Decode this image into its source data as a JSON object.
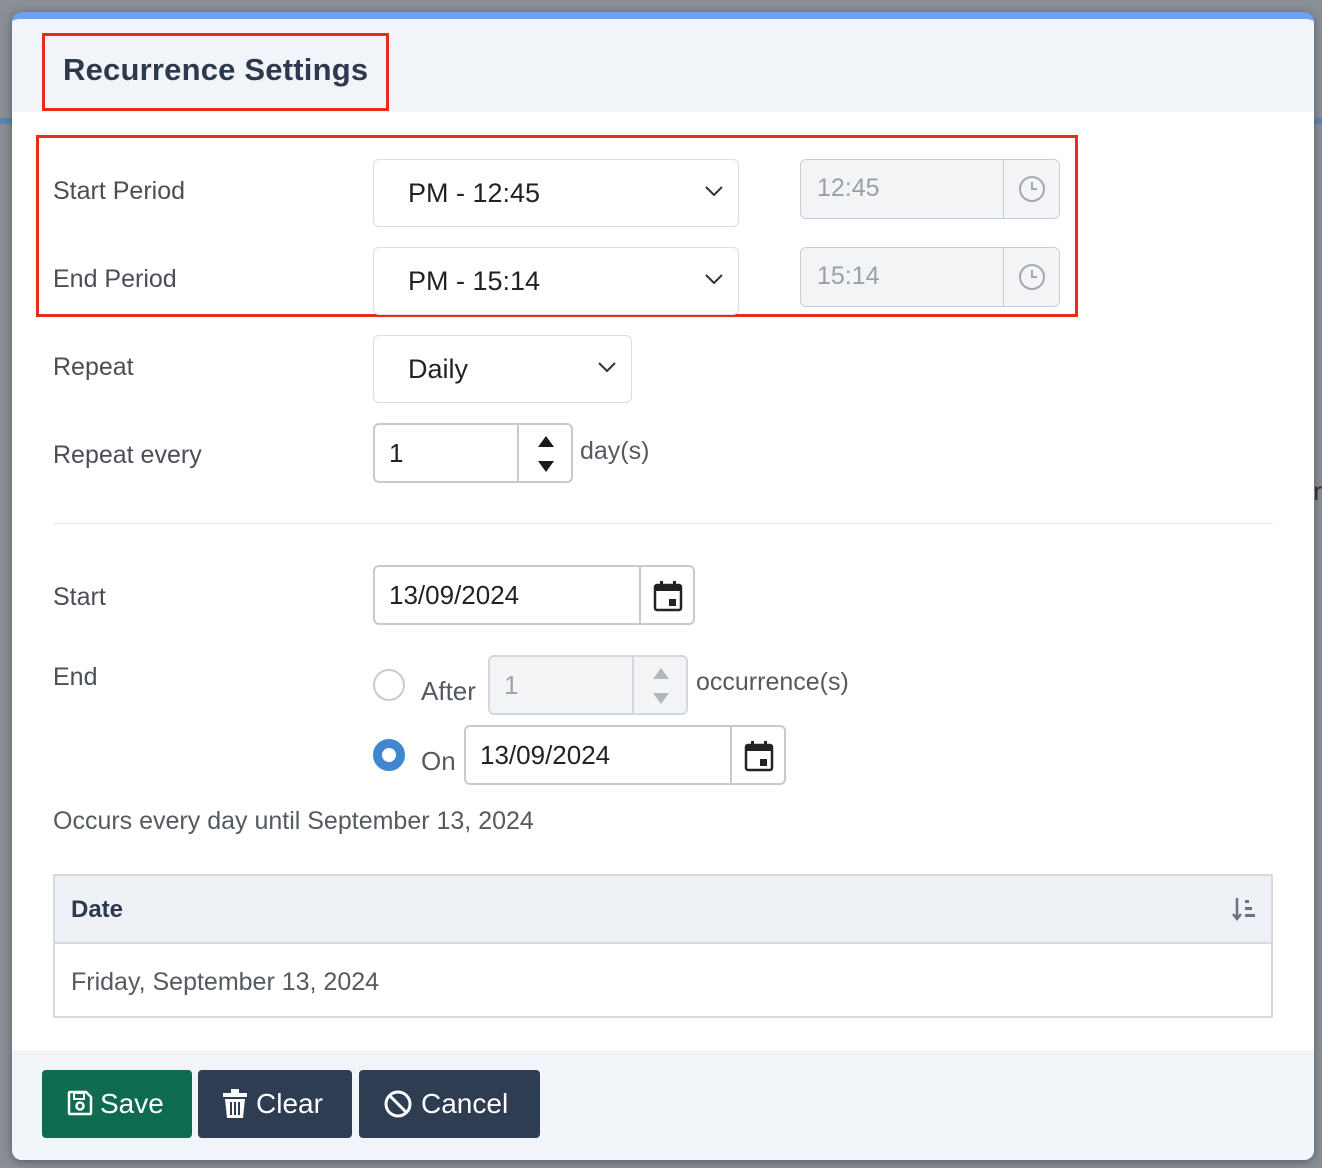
{
  "dialog": {
    "title": "Recurrence Settings"
  },
  "period": {
    "start_label": "Start Period",
    "start_select": "PM - 12:45",
    "start_time": "12:45",
    "end_label": "End Period",
    "end_select": "PM - 15:14",
    "end_time": "15:14"
  },
  "repeat": {
    "label": "Repeat",
    "value": "Daily",
    "every_label": "Repeat every",
    "every_value": "1",
    "every_unit": "day(s)"
  },
  "range": {
    "start_label": "Start",
    "start_date": "13/09/2024",
    "end_label": "End",
    "after_label": "After",
    "after_value": "1",
    "after_unit": "occurrence(s)",
    "on_label": "On",
    "on_date": "13/09/2024",
    "selected_end": "On"
  },
  "summary": "Occurs every day until September 13, 2024",
  "table": {
    "header": "Date",
    "rows": [
      "Friday, September 13, 2024"
    ]
  },
  "buttons": {
    "save": "Save",
    "clear": "Clear",
    "cancel": "Cancel"
  },
  "colors": {
    "save": "#0e6b4f",
    "secondary": "#2e3d52",
    "highlight": "#ea2b1b",
    "radio_checked": "#3f88d1",
    "modal_top": "#6aa3ee"
  },
  "icons": {
    "time_addon": "clock-icon",
    "date_addon": "calendar-icon",
    "sort": "sort-descending-icon",
    "save": "floppy-disk-icon",
    "clear": "trash-icon",
    "cancel": "ban-icon"
  }
}
